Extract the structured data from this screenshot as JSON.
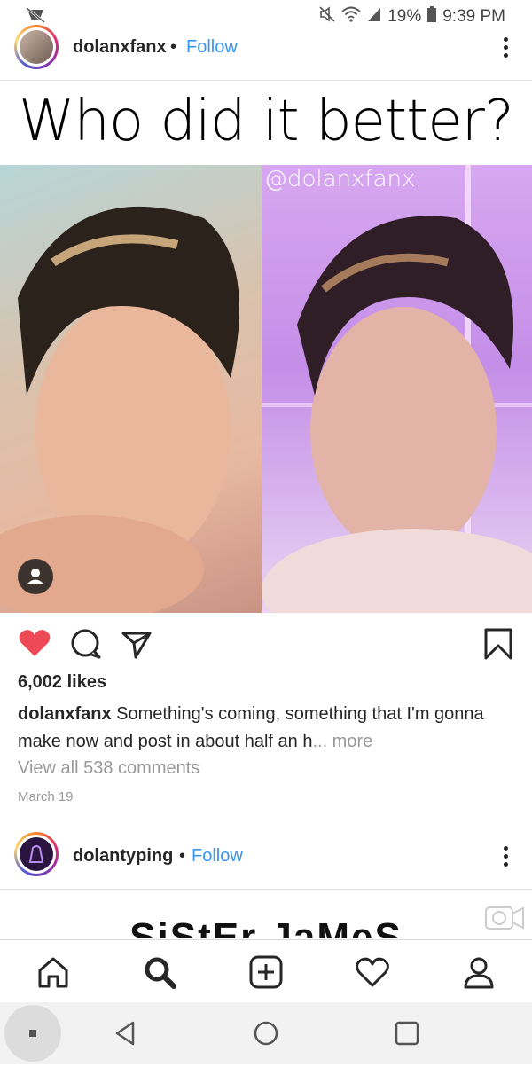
{
  "status_bar": {
    "icons": [
      "notification-off-icon",
      "mute-icon",
      "wifi-icon",
      "signal-icon",
      "battery-icon"
    ],
    "battery": "19%",
    "time": "9:39 PM"
  },
  "post1": {
    "username": "dolanxfanx",
    "separator": "•",
    "follow_label": "Follow",
    "headline": "Who did it better?",
    "watermark": "@dolanxfanx",
    "likes": "6,002 likes",
    "caption_user": "dolanxfanx",
    "caption_text": "Something's coming, something that I'm gonna make now and post in about half an h",
    "more_label": "... more",
    "comments_link": "View all 538 comments",
    "date": "March 19",
    "liked": true
  },
  "post2": {
    "username": "dolantyping",
    "separator": "•",
    "follow_label": "Follow",
    "preview_text": "SiStEr JaMeS"
  },
  "bottom_nav": [
    "home-icon",
    "search-icon",
    "add-post-icon",
    "activity-heart-icon",
    "profile-icon"
  ],
  "system_nav": [
    "back-icon",
    "home-circle-icon",
    "recents-icon"
  ],
  "colors": {
    "accent": "#3897f0",
    "like": "#ed4956",
    "text": "#262626",
    "muted": "#999999"
  }
}
